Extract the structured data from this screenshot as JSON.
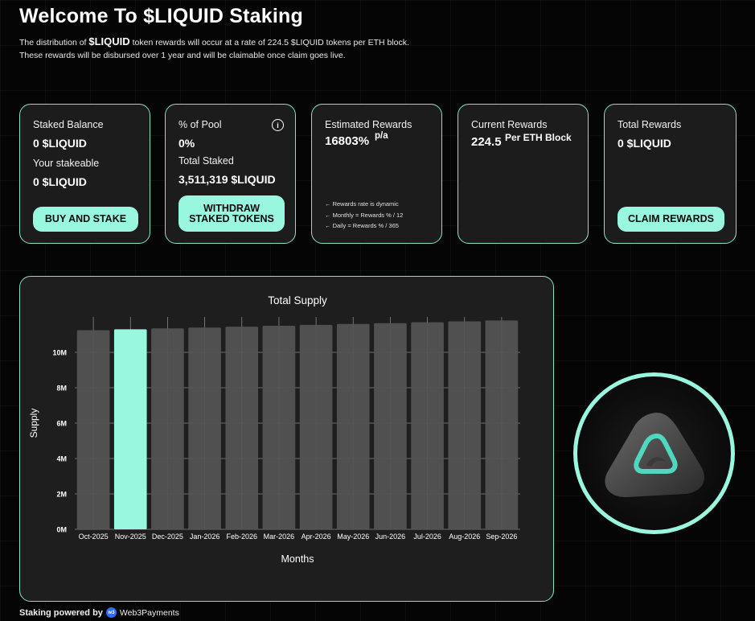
{
  "header": {
    "title": "Welcome To $LIQUID Staking",
    "line1_pre": "The distribution of ",
    "line1_token": "$LIQUID",
    "line1_post": " token rewards will occur at a rate of 224.5 $LIQUID tokens per ETH block.",
    "line2": "These rewards will be disbursed over 1 year and will be claimable once claim goes live."
  },
  "cards": {
    "staked": {
      "label": "Staked Balance",
      "value": "0 $LIQUID",
      "stakeable_label": "Your stakeable",
      "stakeable_value": "0 $LIQUID",
      "button": "BUY AND STAKE"
    },
    "pool": {
      "label": "% of Pool",
      "info_icon": "i",
      "value": "0%",
      "total_label": "Total Staked",
      "total_value": "3,511,319 $LIQUID",
      "button_line1": "WITHDRAW",
      "button_line2": "STAKED TOKENS"
    },
    "estimated": {
      "label": "Estimated Rewards",
      "value": "16803%",
      "unit": "p/a",
      "notes": [
        "← Rewards rate is dynamic",
        "← Monthly = Rewards % / 12",
        "← Daily = Rewards % / 365"
      ]
    },
    "current": {
      "label": "Current Rewards",
      "value": "224.5",
      "unit": "Per ETH Block"
    },
    "total": {
      "label": "Total Rewards",
      "value": "0 $LIQUID",
      "button": "CLAIM REWARDS"
    }
  },
  "chart_data": {
    "type": "bar",
    "title": "Total Supply",
    "xlabel": "Months",
    "ylabel": "Supply",
    "categories": [
      "Oct-2025",
      "Nov-2025",
      "Dec-2025",
      "Jan-2026",
      "Feb-2026",
      "Mar-2026",
      "Apr-2026",
      "May-2026",
      "Jun-2026",
      "Jul-2026",
      "Aug-2026",
      "Sep-2026"
    ],
    "values": [
      11250000,
      11300000,
      11350000,
      11400000,
      11450000,
      11500000,
      11550000,
      11600000,
      11650000,
      11700000,
      11750000,
      11800000
    ],
    "highlight_index": 1,
    "ylim": [
      0,
      12000000
    ],
    "yticks": [
      0,
      2000000,
      4000000,
      6000000,
      8000000,
      10000000
    ],
    "ytick_labels": [
      "0M",
      "2M",
      "4M",
      "6M",
      "8M",
      "10M"
    ],
    "grid": true,
    "colors": {
      "bar": "#555555",
      "highlight": "#98f7de",
      "grid": "#888888"
    }
  },
  "footer": {
    "text": "Staking powered by",
    "brand": "Web3Payments",
    "brand_icon": "w3"
  },
  "colors": {
    "accent": "#98f7de",
    "border": "#86e3c9",
    "card_bg": "#1c1c1c"
  },
  "logo": {
    "icon": "liquid-logo-icon"
  }
}
